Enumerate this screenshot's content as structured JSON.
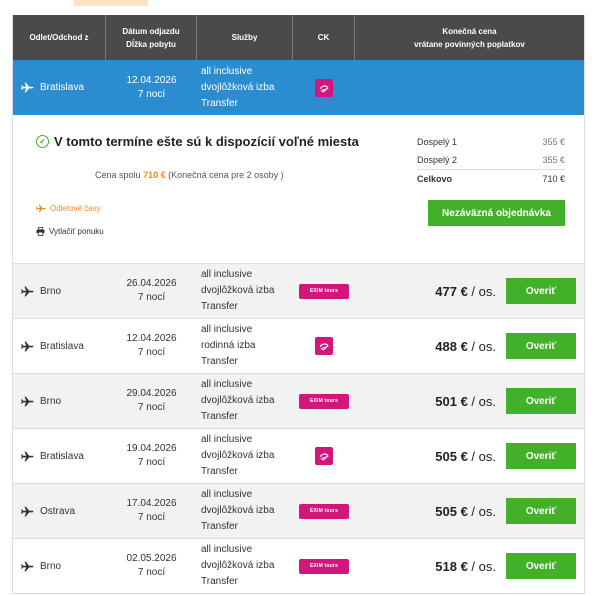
{
  "header": {
    "col1": "Odlet/Odchod z",
    "col2_line1": "Dátum odjazdu",
    "col2_line2": "Dĺžka pobytu",
    "col3": "Služby",
    "col4": "CK",
    "col5_line1": "Konečná cena",
    "col5_line2": "vrátane povinných poplatkov"
  },
  "selected": {
    "city": "Bratislava",
    "date": "12.04.2026",
    "nights": "7 nocí",
    "service1": "all inclusive",
    "service2": "dvojlôžková izba",
    "service3": "Transfer",
    "operator": "cedok-logo"
  },
  "detail": {
    "availability": "V tomto termíne ešte sú k dispozícií voľné miesta",
    "total_prefix": "Cena spolu",
    "total_value": "710 €",
    "total_suffix": "(Konečná cena pre 2 osoby )",
    "flight_times_link": "Odletové časy",
    "print_link": "Vytlačiť ponuku",
    "adult1_label": "Dospelý 1",
    "adult1_price": "355 €",
    "adult2_label": "Dospelý 2",
    "adult2_price": "355 €",
    "total_label": "Celkovo",
    "total_price": "710 €",
    "order_button": "Nezáväzná objednávka"
  },
  "rows": [
    {
      "city": "Brno",
      "date": "26.04.2026",
      "nights": "7 nocí",
      "s1": "all inclusive",
      "s2": "dvojlôžková izba",
      "s3": "Transfer",
      "logo": "EXIM tours",
      "price": "477 €",
      "per": " / os.",
      "button": "Overiť"
    },
    {
      "city": "Bratislava",
      "date": "12.04.2026",
      "nights": "7 nocí",
      "s1": "all inclusive",
      "s2": "rodinná izba",
      "s3": "Transfer",
      "logo": "cedok",
      "price": "488 €",
      "per": " / os.",
      "button": "Overiť"
    },
    {
      "city": "Brno",
      "date": "29.04.2026",
      "nights": "7 nocí",
      "s1": "all inclusive",
      "s2": "dvojlôžková izba",
      "s3": "Transfer",
      "logo": "EXIM tours",
      "price": "501 €",
      "per": " / os.",
      "button": "Overiť"
    },
    {
      "city": "Bratislava",
      "date": "19.04.2026",
      "nights": "7 nocí",
      "s1": "all inclusive",
      "s2": "dvojlôžková izba",
      "s3": "Transfer",
      "logo": "cedok",
      "price": "505 €",
      "per": " / os.",
      "button": "Overiť"
    },
    {
      "city": "Ostrava",
      "date": "17.04.2026",
      "nights": "7 nocí",
      "s1": "all inclusive",
      "s2": "dvojlôžková izba",
      "s3": "Transfer",
      "logo": "EXIM tours",
      "price": "505 €",
      "per": " / os.",
      "button": "Overiť"
    },
    {
      "city": "Brno",
      "date": "02.05.2026",
      "nights": "7 nocí",
      "s1": "all inclusive",
      "s2": "dvojlôžková izba",
      "s3": "Transfer",
      "logo": "EXIM tours",
      "price": "518 €",
      "per": " / os.",
      "button": "Overiť"
    }
  ],
  "colors": {
    "header_bg": "#4a4a4a",
    "selected_bg": "#2b8dcf",
    "button_green": "#43b02a",
    "accent_orange": "#f08a24",
    "logo_pink": "#d4157c"
  }
}
